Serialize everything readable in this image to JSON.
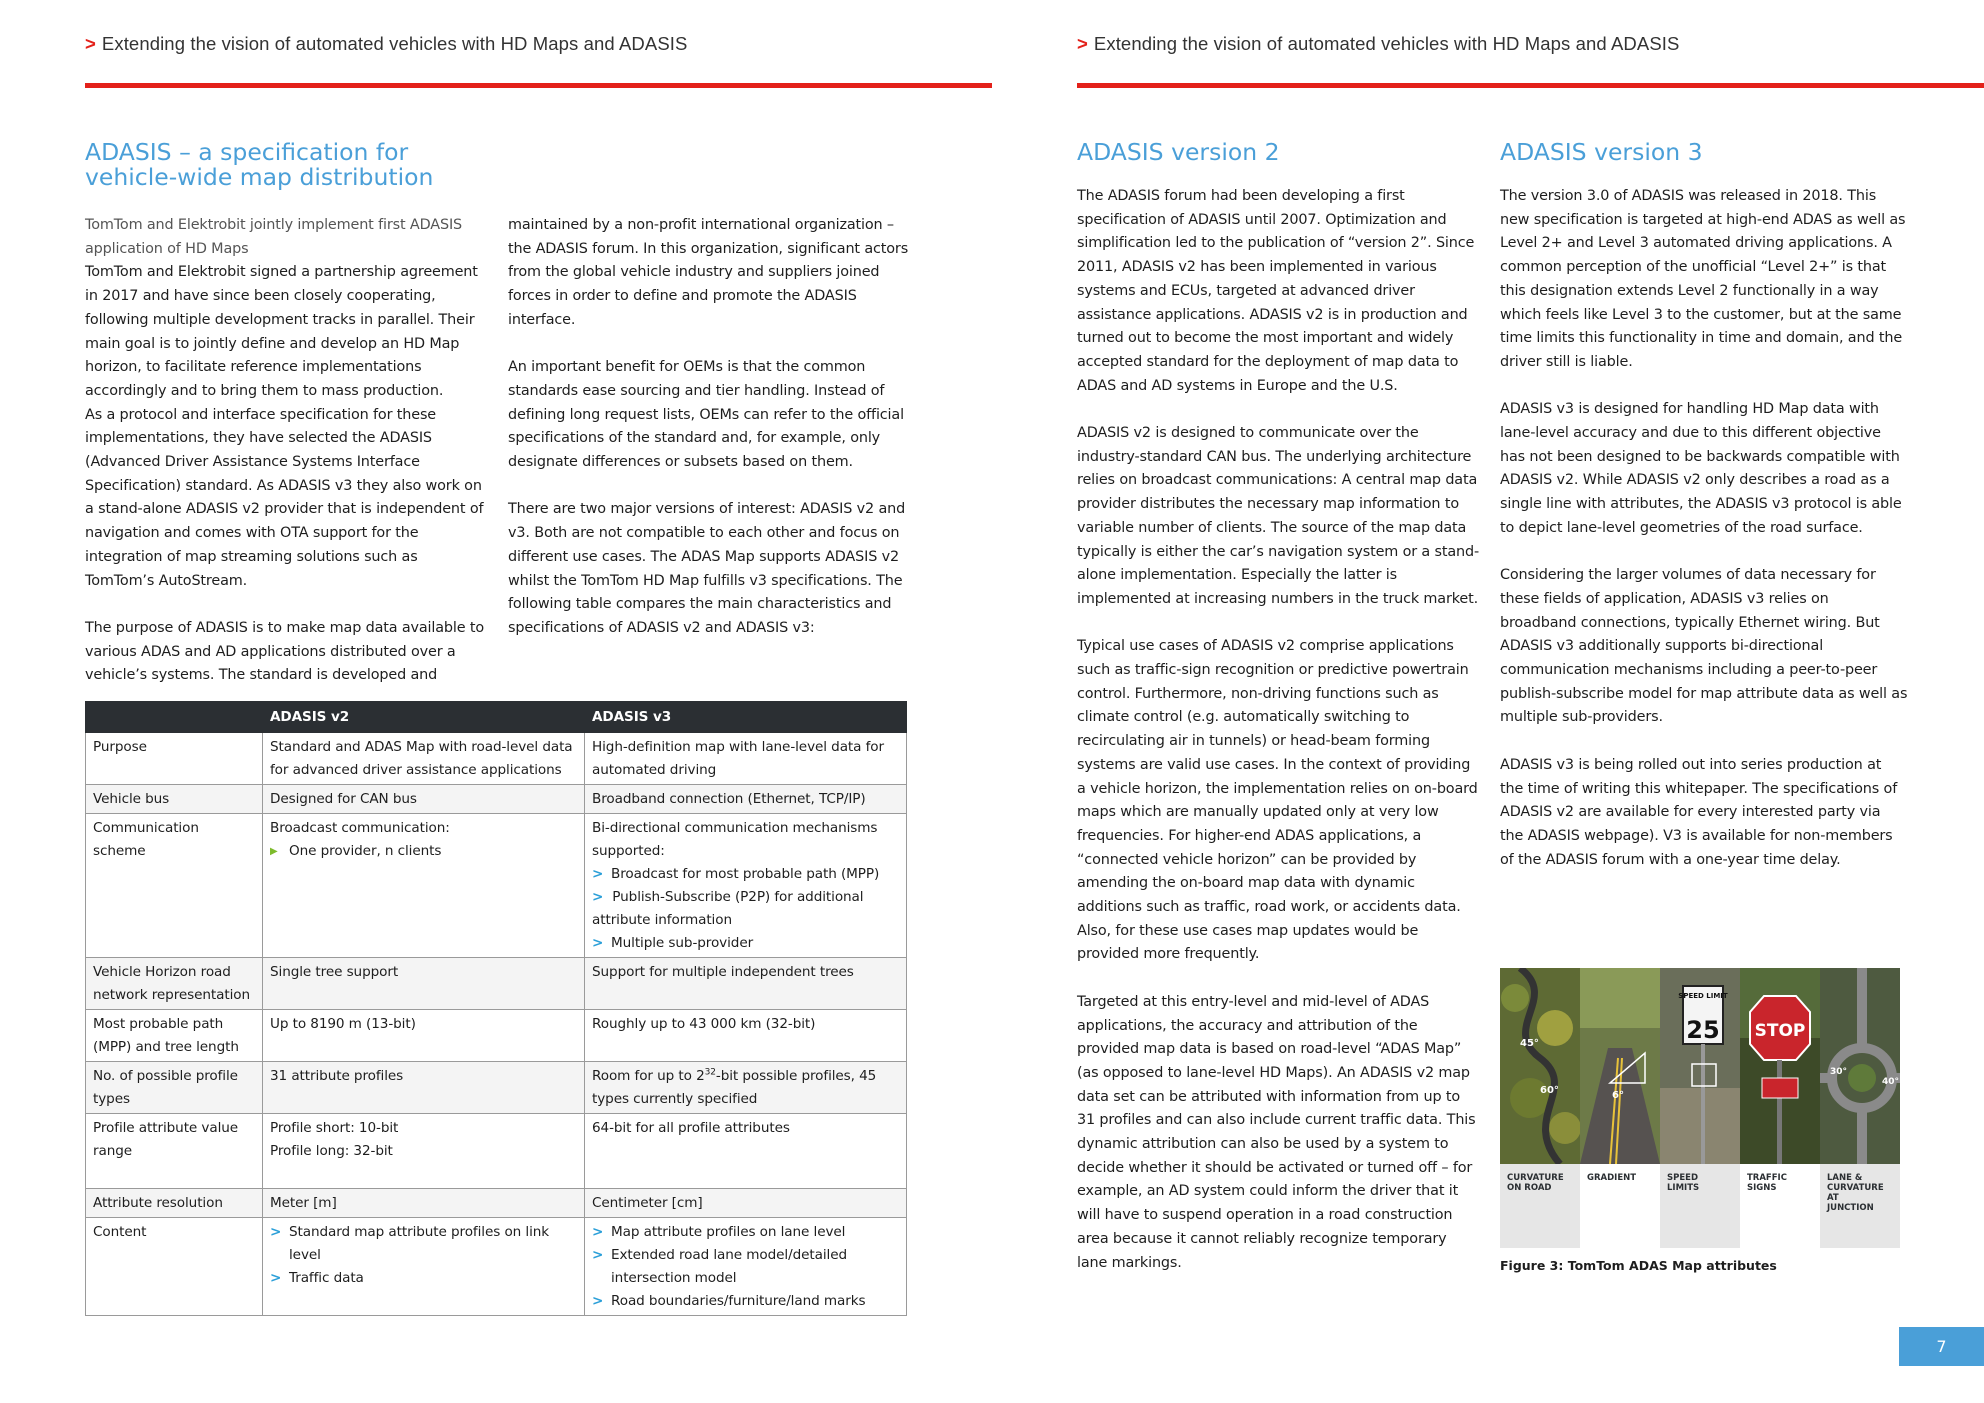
{
  "header": {
    "chevron": ">",
    "left_title": "Extending the vision of automated vehicles with HD Maps and ADASIS",
    "right_title": "Extending the vision of automated vehicles with HD Maps and ADASIS"
  },
  "left": {
    "title_line1": "ADASIS – a specification for",
    "title_line2": "vehicle-wide map distribution",
    "col1": {
      "sub_line1": "TomTom and Elektrobit jointly implement first ADASIS",
      "sub_line2": "application of HD Maps",
      "p1": "TomTom and Elektrobit signed a partnership agreement in 2017 and have since been closely cooperating, following multiple development tracks in parallel. Their main goal is to jointly define and develop an HD Map horizon, to facilitate reference implementations accordingly and to bring them to mass production.",
      "p2": "As a protocol and interface specification for these implementations, they have selected the ADASIS (Advanced Driver Assistance Systems Interface Specification) standard. As ADASIS v3 they also work on a stand-alone ADASIS v2 provider that is independent of navigation and comes with OTA support for the integration of map streaming solutions such as TomTom’s AutoStream.",
      "p3": "The purpose of ADASIS is to make map data available to various ADAS and AD applications distributed over a vehicle’s systems. The standard is developed and"
    },
    "col2": {
      "p1": "maintained by a non-profit international organization – the ADASIS forum. In this organization, significant actors from the global vehicle industry and suppliers joined forces in order to define and promote the ADASIS interface.",
      "p2": "An important benefit for OEMs is that the common standards ease sourcing and tier handling. Instead of defining long request lists, OEMs can refer to the official specifications of the standard and, for example, only designate differences or subsets based on them.",
      "p3": "There are two major versions of interest: ADASIS v2 and v3. Both are not compatible to each other and focus on different use cases. The ADAS Map supports ADASIS v2 whilst the TomTom HD Map fulfills v3 specifications. The following table compares the main characteristics and specifications of ADASIS v2 and ADASIS v3:"
    }
  },
  "table": {
    "headers": [
      "",
      "ADASIS v2",
      "ADASIS v3"
    ],
    "purpose": {
      "label": "Purpose",
      "v2": "Standard and ADAS Map with road-level data for advanced driver assistance applications",
      "v3": "High-definition map with lane-level data for automated driving"
    },
    "bus": {
      "label": "Vehicle bus",
      "v2": "Designed for CAN bus",
      "v3": "Broadband connection (Ethernet, TCP/IP)"
    },
    "comm": {
      "label": "Communication scheme",
      "v2": "Broadcast communication:",
      "v2_bullet": "One provider, n clients",
      "v3": "Bi-directional communication mechanisms supported:",
      "v3_b1": "Broadcast for most probable path (MPP)",
      "v3_b2": "Publish-Subscribe (P2P) for additional attribute information",
      "v3_b3": "Multiple sub-provider"
    },
    "horizon": {
      "label": "Vehicle Horizon road network representation",
      "v2": "Single tree support",
      "v3": "Support for multiple independent trees"
    },
    "mpp": {
      "label": "Most probable path (MPP) and tree length",
      "v2": "Up to 8190 m (13-bit)",
      "v3": "Roughly up to 43 000 km (32-bit)"
    },
    "profiles": {
      "label": "No. of possible profile types",
      "v2": "31 attribute profiles",
      "v3_pre": "Room for up to 2",
      "v3_sup": "32",
      "v3_post": "-bit possible profiles, 45 types currently specified"
    },
    "range": {
      "label": "Profile attribute value range",
      "v2_l1": "Profile short: 10-bit",
      "v2_l2": "Profile long: 32-bit",
      "v3": "64-bit for all profile attributes"
    },
    "resolution": {
      "label": "Attribute resolution",
      "v2": "Meter [m]",
      "v3": "Centimeter [cm]"
    },
    "content": {
      "label": "Content",
      "v2_b1": "Standard map attribute profiles on link level",
      "v2_b2": "Traffic data",
      "v3_b1": "Map attribute profiles on lane level",
      "v3_b2": "Extended road lane model/detailed intersection model",
      "v3_b3": "Road boundaries/furniture/land marks"
    },
    "bullet_chevron": ">",
    "bullet_triangle": "▶"
  },
  "right": {
    "v2": {
      "title": "ADASIS version 2",
      "p1": "The ADASIS forum had been developing a first specification of ADASIS until 2007. Optimization and simplification led to the publication of “version 2”. Since 2011, ADASIS v2 has been implemented in various systems and ECUs, targeted at advanced driver assistance applications. ADASIS v2 is in production and turned out to become the most important and widely accepted standard for the deployment of map data to ADAS and AD systems in Europe and the U.S.",
      "p2": "ADASIS v2 is designed to communicate over the industry-standard CAN bus. The underlying architecture relies on broadcast communications: A central map data provider distributes the necessary map information to variable number of clients. The source of the map data typically is either the car’s navigation system or a stand-alone implementation. Especially the latter is implemented at increasing numbers in the truck market.",
      "p3": "Typical use cases of ADASIS v2 comprise applications such as traffic-sign recognition or predictive powertrain control. Furthermore, non-driving functions such as climate control (e.g. automatically switching to recirculating air in tunnels) or head-beam forming systems are valid use cases. In the context of providing a vehicle horizon, the implementation relies on on-board maps which are manually updated only at very low frequencies. For higher-end ADAS applications, a “connected vehicle horizon” can be provided by amending the on-board map data with dynamic additions such as traffic, road work, or accidents data. Also, for these use cases map updates would be provided more frequently.",
      "p4": "Targeted at this entry-level and mid-level of ADAS applications, the accuracy and attribution of the provided map data is based on road-level “ADAS Map” (as opposed to lane-level HD Maps). An ADASIS v2 map data set can be attributed with information from up to 31 profiles and can also include current traffic data. This dynamic attribution can also be used by a system to decide whether it should be activated or turned off – for example, an AD system could inform the driver that it will have to suspend operation in a road construction area because it cannot reliably recognize temporary lane markings."
    },
    "v3": {
      "title": "ADASIS version 3",
      "p1": "The version 3.0 of ADASIS was released in 2018. This new specification is targeted at high-end ADAS as well as Level 2+ and Level 3 automated driving applications. A common perception of the unofficial “Level 2+” is that this designation extends Level 2 functionally in a way which feels like Level 3 to the customer, but at the same time limits this functionality in time and domain, and the driver still is liable.",
      "p2": "ADASIS v3 is designed for handling HD Map data with lane-level accuracy and due to this different objective has not been designed to be backwards compatible with ADASIS v2. While ADASIS v2 only describes a road as a single line with attributes, the ADASIS v3 protocol is able to depict lane-level geometries of the road surface.",
      "p3": "Considering the larger volumes of data necessary for these fields of application, ADASIS v3 relies on broadband connections, typically Ethernet wiring. But ADASIS v3 additionally supports bi-directional communication mechanisms including a peer-to-peer publish-subscribe model for map attribute data as well as multiple sub-providers.",
      "p4": "ADASIS v3 is being rolled out into series production at the time of writing this whitepaper. The specifications of ADASIS v2 are available for every interested party via the ADASIS webpage). V3 is available for non-members of the ADASIS forum with a one-year time delay."
    },
    "figure": {
      "labels": [
        "CURVATURE ON ROAD",
        "GRADIENT",
        "SPEED LIMITS",
        "TRAFFIC SIGNS",
        "LANE & CURVATURE AT JUNCTION"
      ],
      "deg_45": "45°",
      "deg_60": "60°",
      "deg_6": "6°",
      "deg_30": "30°",
      "deg_40": "40°",
      "speed_sign_title": "SPEED LIMIT",
      "speed_sign_value": "25",
      "stop_text": "STOP",
      "caption": "Figure 3: TomTom ADAS Map attributes"
    },
    "page_number": "7"
  },
  "colors": {
    "accent_blue": "#4a9fd8",
    "header_red": "#e3211a",
    "table_header": "#2b2f33"
  }
}
